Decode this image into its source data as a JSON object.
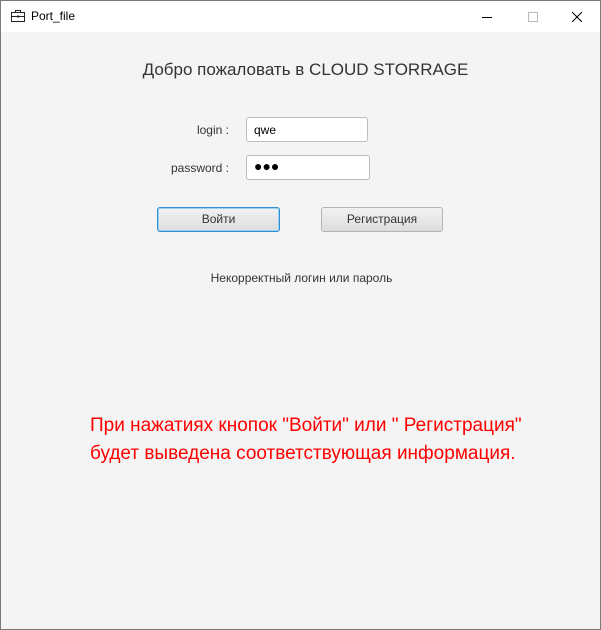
{
  "window": {
    "title": "Port_file",
    "icon": "briefcase-icon",
    "controls": [
      "minimize-icon",
      "maximize-icon",
      "close-icon"
    ]
  },
  "header": {
    "title": "Добро пожаловать в CLOUD STORRAGE"
  },
  "form": {
    "login_label": "login :",
    "login_value": "qwe",
    "password_label": "password :",
    "password_value": "●●●",
    "login_button": "Войти",
    "register_button": "Регистрация"
  },
  "status": {
    "message": "Некорректный логин или пароль"
  },
  "annotation": {
    "line1": "При нажатиях кнопок \"Войти\" или \" Регистрация\"",
    "line2": "будет выведена соответствующая информация.",
    "color": "#ff0000"
  },
  "colors": {
    "background": "#f4f4f4",
    "focus_border": "#2f8fd0"
  }
}
